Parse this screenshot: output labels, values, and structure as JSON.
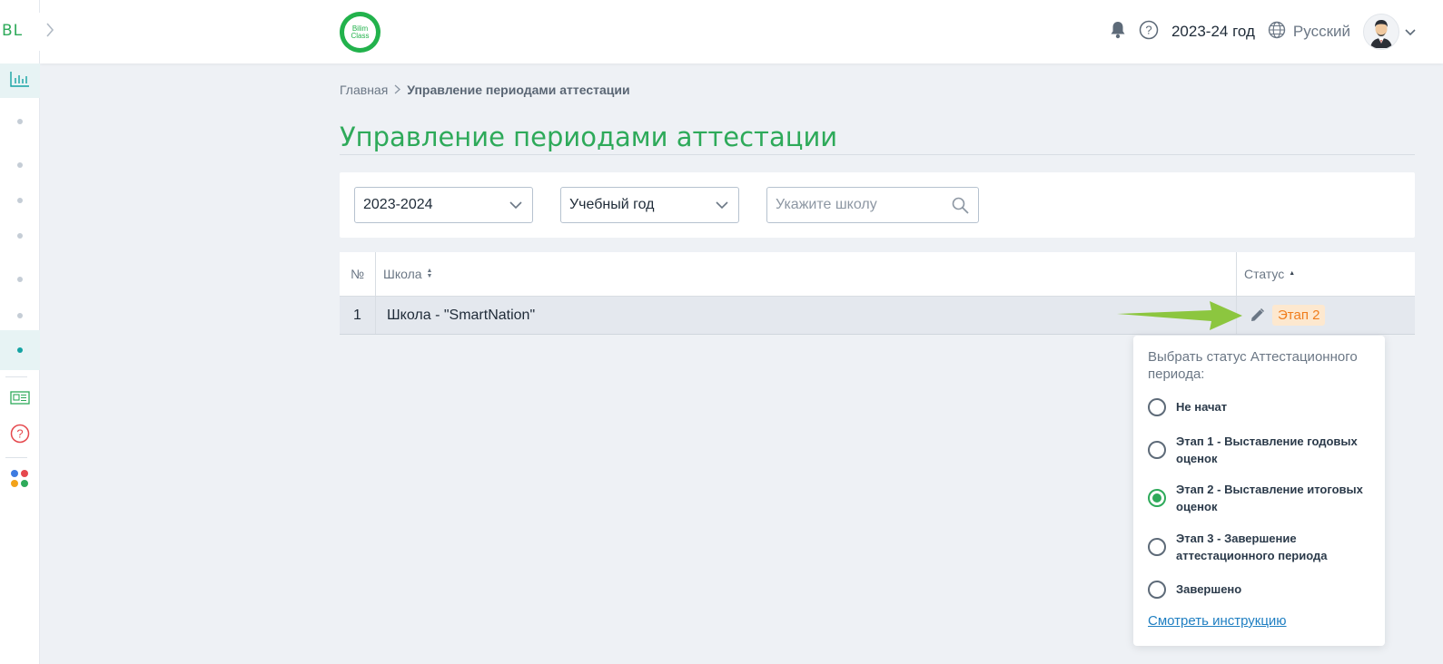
{
  "sidebar": {
    "logo_text": "BL",
    "expand_icon": "chevron-right-icon",
    "items": [
      {
        "icon": "bar-chart-icon"
      },
      {
        "icon": "dot"
      },
      {
        "icon": "dot"
      },
      {
        "icon": "dot"
      },
      {
        "icon": "dot"
      },
      {
        "icon": "dot"
      },
      {
        "icon": "dot"
      },
      {
        "icon": "dot",
        "active": true
      },
      {
        "icon": "news-icon"
      },
      {
        "icon": "help-circle-icon"
      },
      {
        "icon": "apps-icon"
      }
    ]
  },
  "topbar": {
    "brand_line1": "Bilim",
    "brand_line2": "Class",
    "year": "2023-24 год",
    "language": "Русский"
  },
  "breadcrumb": {
    "home": "Главная",
    "current": "Управление периодами аттестации"
  },
  "page": {
    "title": "Управление периодами аттестации"
  },
  "filters": {
    "year_select": "2023-2024",
    "period_select": "Учебный год",
    "school_search_placeholder": "Укажите школу"
  },
  "table": {
    "headers": {
      "num": "№",
      "school": "Школа",
      "status": "Статус"
    },
    "rows": [
      {
        "num": "1",
        "school": "Школа - \"SmartNation\"",
        "status": "Этап 2"
      }
    ]
  },
  "status_popover": {
    "title": "Выбрать статус Аттестационного периода:",
    "options": [
      {
        "label": "Не начат",
        "checked": false
      },
      {
        "label": "Этап 1 - Выставление годовых оценок",
        "checked": false
      },
      {
        "label": "Этап 2 - Выставление итоговых оценок",
        "checked": true
      },
      {
        "label": "Этап 3 - Завершение аттестационного периода",
        "checked": false
      },
      {
        "label": "Завершено",
        "checked": false
      }
    ],
    "instruction_link": "Смотреть инструкцию"
  },
  "colors": {
    "brand_green": "#2eaa5a",
    "status_orange": "#f07d1c",
    "status_badge_bg": "#fde8cf",
    "link_blue": "#1f7fc2",
    "arrow_green": "#8cc63f"
  }
}
